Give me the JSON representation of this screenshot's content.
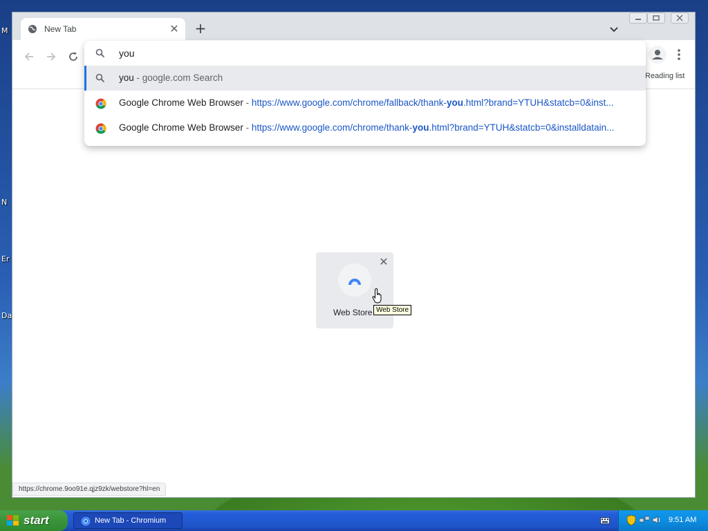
{
  "desktop": {
    "labels": [
      "M",
      "N",
      "Er",
      "Da"
    ]
  },
  "browser": {
    "tab": {
      "title": "New Tab"
    },
    "omnibox": {
      "value": "you",
      "suggestions": [
        {
          "type": "search",
          "query": "you",
          "separator": " - ",
          "description": "google.com Search"
        },
        {
          "type": "history",
          "title": "Google Chrome Web Browser",
          "separator": " - ",
          "url_prefix": "https://www.google.com/chrome/fallback/thank-",
          "url_match": "you",
          "url_suffix": ".html?brand=YTUH&statcb=0&inst..."
        },
        {
          "type": "history",
          "title": "Google Chrome Web Browser",
          "separator": " - ",
          "url_prefix": "https://www.google.com/chrome/thank-",
          "url_match": "you",
          "url_suffix": ".html?brand=YTUH&statcb=0&installdatain..."
        }
      ]
    },
    "reading_list": "Reading list",
    "shortcut": {
      "label": "Web Store",
      "tooltip": "Web Store"
    },
    "status_url": "https://chrome.9oo91e.qjz9zk/webstore?hl=en"
  },
  "taskbar": {
    "start_label": "start",
    "task_button": "New Tab - Chromium",
    "clock": "9:51 AM"
  },
  "colors": {
    "accent": "#1a73e8",
    "link": "#1a56c6",
    "taskbar": "#245edb",
    "start_green": "#3c963c"
  }
}
